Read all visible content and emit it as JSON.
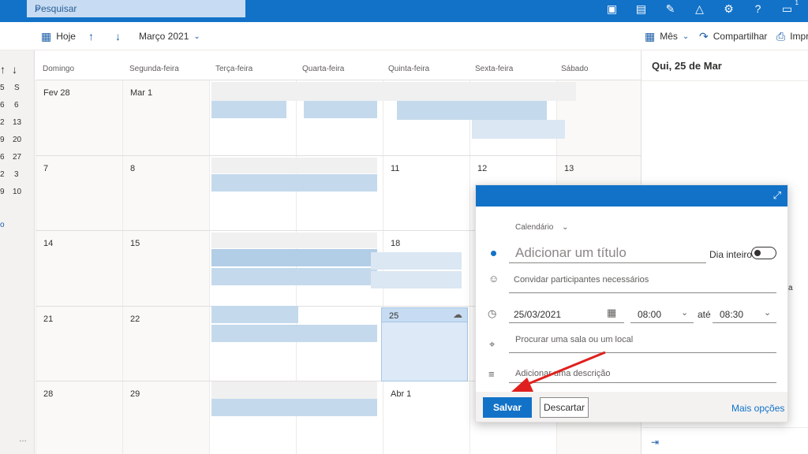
{
  "topbar": {
    "search_placeholder": "Pesquisar",
    "notification_count": "1"
  },
  "cmdbar": {
    "today": "Hoje",
    "month_label": "Março 2021",
    "view": "Mês",
    "share": "Compartilhar",
    "print": "Impr"
  },
  "mini": {
    "rows": [
      "S",
      "6",
      "13",
      "20",
      "27",
      "3",
      "10"
    ],
    "left_digits": [
      "5",
      "6",
      "2",
      "9",
      "6",
      "2",
      "9"
    ],
    "more": "…"
  },
  "calendar": {
    "day_names": [
      "Domingo",
      "Segunda-feira",
      "Terça-feira",
      "Quarta-feira",
      "Quinta-feira",
      "Sexta-feira",
      "Sábado"
    ],
    "weeks": [
      [
        "Fev 28",
        "Mar 1",
        "",
        "",
        "",
        "",
        ""
      ],
      [
        "7",
        "8",
        "",
        "",
        "11",
        "12",
        "13"
      ],
      [
        "14",
        "15",
        "",
        "",
        "18",
        "",
        ""
      ],
      [
        "21",
        "22",
        "",
        "",
        "25",
        "",
        ""
      ],
      [
        "28",
        "29",
        "",
        "",
        "Abr 1",
        "",
        ""
      ]
    ]
  },
  "rpane": {
    "title": "Qui, 25 de Mar",
    "cut_text": "a"
  },
  "popup": {
    "calendar_label": "Calendário",
    "title_placeholder": "Adicionar um título",
    "all_day": "Dia inteiro",
    "attendees_placeholder": "Convidar participantes necessários",
    "date": "25/03/2021",
    "start_time": "08:00",
    "until": "até",
    "end_time": "08:30",
    "location_placeholder": "Procurar uma sala ou um local",
    "description_placeholder": "Adicionar uma descrição",
    "save": "Salvar",
    "discard": "Descartar",
    "more_options": "Mais opções"
  },
  "colors": {
    "accent": "#1272c8",
    "arrow": "#e0201e"
  }
}
